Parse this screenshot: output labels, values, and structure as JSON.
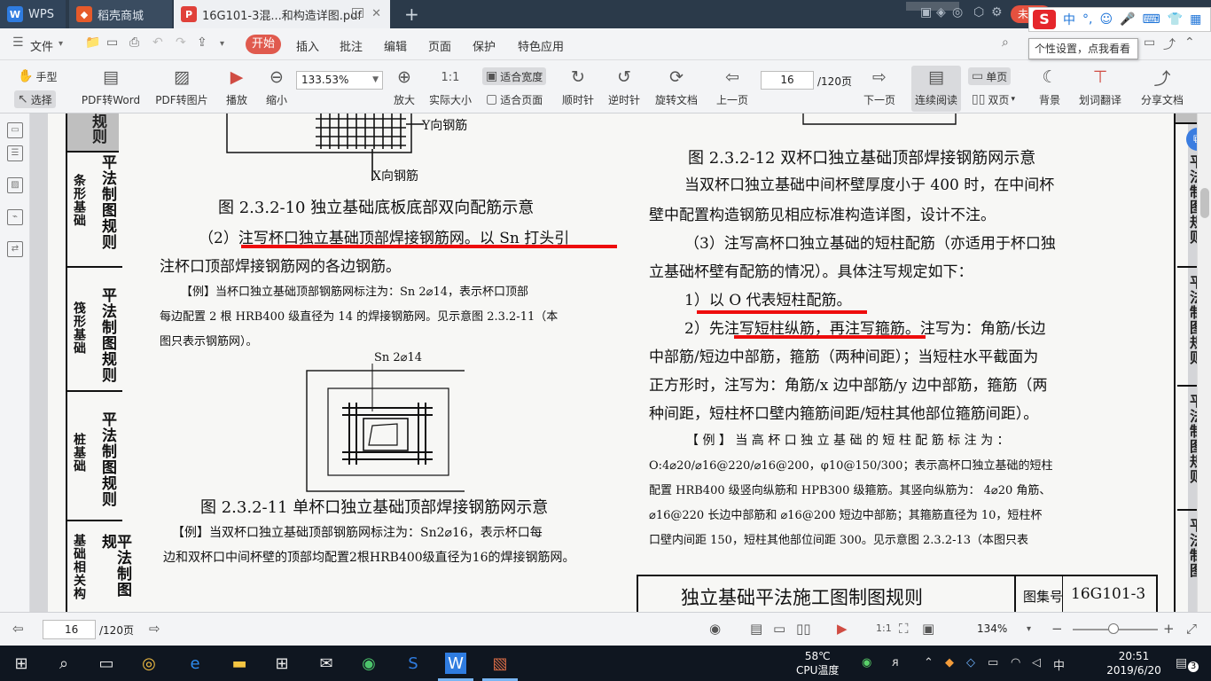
{
  "titlebar": {
    "tabs": [
      {
        "label": "WPS",
        "icon": "wps-logo-icon"
      },
      {
        "label": "稻壳商城",
        "icon": "docer-icon"
      },
      {
        "label": "16G101-3混...和构造详图.pdf",
        "icon": "pdf-icon"
      }
    ],
    "login_label": "未登录",
    "ime_tooltip": "个性设置，点我看看",
    "ime_chars": [
      "中",
      "°,",
      "☺",
      "🎤",
      "⌨",
      "👕",
      "▦"
    ]
  },
  "menubar": {
    "file_label": "文件",
    "items": [
      "开始",
      "插入",
      "批注",
      "编辑",
      "页面",
      "保护",
      "特色应用"
    ]
  },
  "toolbar": {
    "hand_label": "手型",
    "select_label": "选择",
    "pdf_to_word": "PDF转Word",
    "pdf_to_image": "PDF转图片",
    "play": "播放",
    "zoom_out": "缩小",
    "zoom_value": "133.53%",
    "zoom_in": "放大",
    "actual_size": "实际大小",
    "fit_width": "适合宽度",
    "fit_page": "适合页面",
    "rotate_cw": "顺时针",
    "rotate_ccw": "逆时针",
    "rotate_doc": "旋转文档",
    "prev_page": "上一页",
    "page_value": "16",
    "page_total": "/120页",
    "next_page": "下一页",
    "continuous": "连续阅读",
    "single_page": "单页",
    "double_page": "双页",
    "background": "背景",
    "translate": "划词翻译",
    "share": "分享文档"
  },
  "doc": {
    "left_tabs": [
      {
        "big": "规则",
        "small": ""
      },
      {
        "big": "平法制图规则",
        "small": "条形基础"
      },
      {
        "big": "平法制图规则",
        "small": "筏形基础"
      },
      {
        "big": "平法制图规则",
        "small": "桩基础"
      },
      {
        "big": "平法制图规",
        "small": "基础相关构"
      }
    ],
    "right_tabs": [
      "平法制图规则",
      "平法制图规则",
      "平法制图规则",
      "平法制图"
    ],
    "fig_top_label_y": "Y向钢筋",
    "fig_top_label_x": "X向钢筋",
    "caption_10": "图 2.3.2-10  独立基础底板底部双向配筋示意",
    "para2_line1": "（2）注写杯口独立基础顶部焊接钢筋网。以 Sn 打头引",
    "para2_line2": "注杯口顶部焊接钢筋网的各边钢筋。",
    "ex1_line1": "【例】当杯口独立基础顶部钢筋网标注为：Sn 2⌀14，表示杯口顶部",
    "ex1_line2": "每边配置 2 根 HRB400 级直径为 14 的焊接钢筋网。见示意图 2.3.2-11（本",
    "ex1_line3": "图只表示钢筋网）。",
    "fig11_label": "Sn 2⌀14",
    "caption_11": "图 2.3.2-11 单杯口独立基础顶部焊接钢筋网示意",
    "ex2_line1": "【例】当双杯口独立基础顶部钢筋网标注为：Sn2⌀16，表示杯口每",
    "ex2_line2": "边和双杯口中间杯壁的顶部均配置2根HRB400级直径为16的焊接钢筋网。",
    "caption_12": "图 2.3.2-12 双杯口独立基础顶部焊接钢筋网示意",
    "r_line1": "当双杯口独立基础中间杯壁厚度小于 400 时，在中间杯",
    "r_line2": "壁中配置构造钢筋见相应标准构造详图，设计不注。",
    "r_line3": "（3）注写高杯口独立基础的短柱配筋（亦适用于杯口独",
    "r_line4": "立基础杯壁有配筋的情况）。具体注写规定如下：",
    "r_line5": "1）以 O 代表短柱配筋。",
    "r_line6": "2）先注写短柱纵筋，再注写箍筋。注写为：角筋/长边",
    "r_line7": "中部筋/短边中部筋，箍筋（两种间距）；当短柱水平截面为",
    "r_line8": "正方形时，注写为：角筋/x 边中部筋/y 边中部筋，箍筋（两",
    "r_line9": "种间距，短柱杯口壁内箍筋间距/短柱其他部位箍筋间距）。",
    "r_ex1": "【 例 】 当 高 杯 口 独 立 基 础 的 短 柱 配 筋 标 注 为 ：",
    "r_ex2": "O:4⌀20/⌀16@220/⌀16@200，φ10@150/300；表示高杯口独立基础的短柱",
    "r_ex3": "配置 HRB400 级竖向纵筋和 HPB300 级箍筋。其竖向纵筋为： 4⌀20 角筋、",
    "r_ex4": "⌀16@220 长边中部筋和 ⌀16@200 短边中部筋；其箍筋直径为 10，短柱杯",
    "r_ex5": "口壁内间距 150，短柱其他部位间距 300。见示意图 2.3.2-13（本图只表",
    "footer_title": "独立基础平法施工图制图规则",
    "footer_atlas_label": "图集号",
    "footer_atlas_value": "16G101-3"
  },
  "statusbar": {
    "page_value": "16",
    "page_total": "/120页",
    "zoom_value": "134%"
  },
  "taskbar": {
    "temp": "58℃",
    "temp_label": "CPU温度",
    "ime": "中",
    "time": "20:51",
    "date": "2019/6/20",
    "notify_count": "3"
  },
  "colors": {
    "titlebar": "#2b3a4a",
    "accent_red": "#e05a4e",
    "underline_red": "#ee0c0c"
  }
}
